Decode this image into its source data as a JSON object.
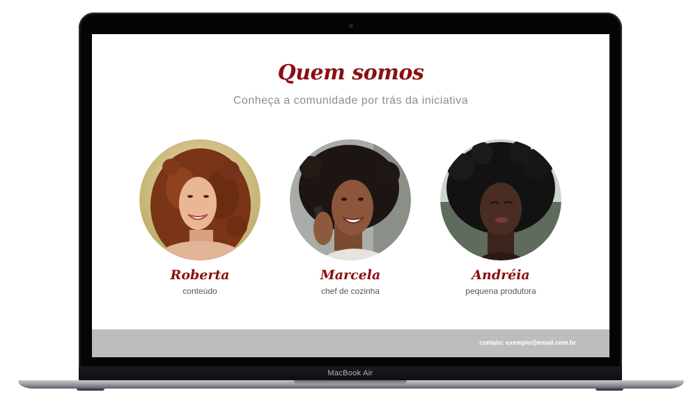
{
  "page": {
    "title": "Quem somos",
    "subtitle": "Conheça a comunidade por trás da iniciativa"
  },
  "members": [
    {
      "name": "Roberta",
      "role": "conteúdo",
      "photo": "portrait-curly-hair-woman"
    },
    {
      "name": "Marcela",
      "role": "chef de cozinha",
      "photo": "portrait-woman-on-phone"
    },
    {
      "name": "Andréia",
      "role": "pequena produtora",
      "photo": "portrait-woman-afro-hair"
    }
  ],
  "footer": {
    "contact": "contato: exemplo@email.com.br"
  },
  "device": {
    "model_label": "MacBook Air"
  },
  "colors": {
    "accent": "#8a0f12",
    "footer_bg": "#bdbdbd",
    "subtitle": "#8c8c8c"
  }
}
